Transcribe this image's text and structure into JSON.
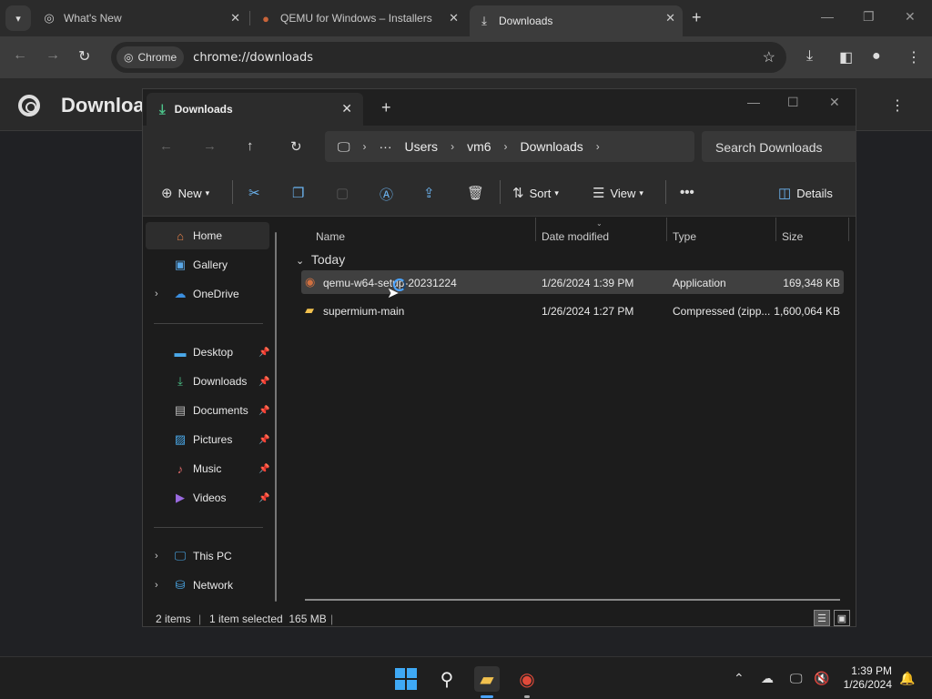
{
  "browser": {
    "tabs": [
      {
        "title": "What's New",
        "icon": "chrome-icon"
      },
      {
        "title": "QEMU for Windows – Installers",
        "icon": "qemu-icon"
      },
      {
        "title": "Downloads",
        "icon": "download-icon"
      }
    ],
    "chip_label": "Chrome",
    "url": "chrome://downloads",
    "page_title": "Downloads"
  },
  "explorer": {
    "tab_title": "Downloads",
    "breadcrumb": [
      "Users",
      "vm6",
      "Downloads"
    ],
    "search_placeholder": "Search Downloads",
    "commands": {
      "new": "New",
      "sort": "Sort",
      "view": "View",
      "details": "Details"
    },
    "nav": {
      "home": "Home",
      "gallery": "Gallery",
      "onedrive": "OneDrive",
      "desktop": "Desktop",
      "downloads": "Downloads",
      "documents": "Documents",
      "pictures": "Pictures",
      "music": "Music",
      "videos": "Videos",
      "thispc": "This PC",
      "network": "Network"
    },
    "columns": {
      "name": "Name",
      "date": "Date modified",
      "type": "Type",
      "size": "Size"
    },
    "group": "Today",
    "files": [
      {
        "name": "qemu-w64-setup-20231224",
        "date": "1/26/2024 1:39 PM",
        "type": "Application",
        "size": "169,348 KB"
      },
      {
        "name": "supermium-main",
        "date": "1/26/2024 1:27 PM",
        "type": "Compressed (zipp...",
        "size": "1,600,064 KB"
      }
    ],
    "status": {
      "items": "2 items",
      "selected": "1 item selected  165 MB"
    }
  },
  "taskbar": {
    "time": "1:39 PM",
    "date": "1/26/2024"
  },
  "colors": {
    "accent": "#3fa9f5",
    "folder": "#f2c14e",
    "download_green": "#4cc38a"
  }
}
